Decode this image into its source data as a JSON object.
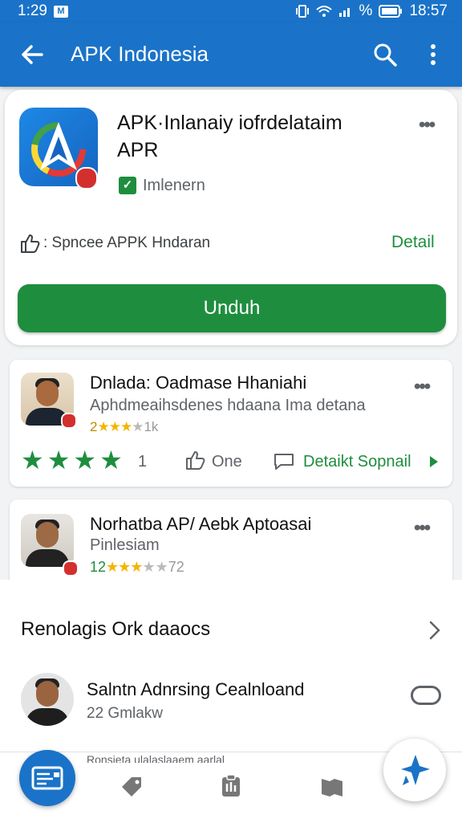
{
  "status_bar": {
    "time_left": "1:29",
    "time_right": "18:57",
    "battery_text": "%"
  },
  "app_bar": {
    "title": "APK Indonesia"
  },
  "app_card": {
    "name_line1": "APK·Inlanaiy iofrdelataim",
    "name_line2": "APR",
    "developer": "Imlenern",
    "info_text": ": Spncee APPK Hndaran",
    "detail_label": "Detail",
    "download_label": "Unduh"
  },
  "review_card_1": {
    "title": "Dnlada: Oadmase Hhaniahi",
    "subtitle": "Aphdmeaihsdenes hdaana Ima detana",
    "rating_prefix": "2",
    "rating_suffix": "1k",
    "stars_value": 4,
    "count": "1",
    "likes_label": "One",
    "comment_label": "Detaikt Sopnail"
  },
  "review_card_2": {
    "title": "Norhatba AP/ Aebk Aptoasai",
    "subtitle": "Pinlesiam",
    "rating_prefix": "12",
    "rating_suffix": "72"
  },
  "section": {
    "title": "Renolagis Ork daaocs"
  },
  "list_item": {
    "title": "Salntn Adnrsing Cealnloand",
    "subtitle": "22 Gmlakw"
  },
  "peek": {
    "text": "Ronsieta ulalaslaaem aarlal"
  },
  "colors": {
    "primary": "#1a73c8",
    "accent_green": "#1e8e3e",
    "star_gold": "#f4b400"
  }
}
